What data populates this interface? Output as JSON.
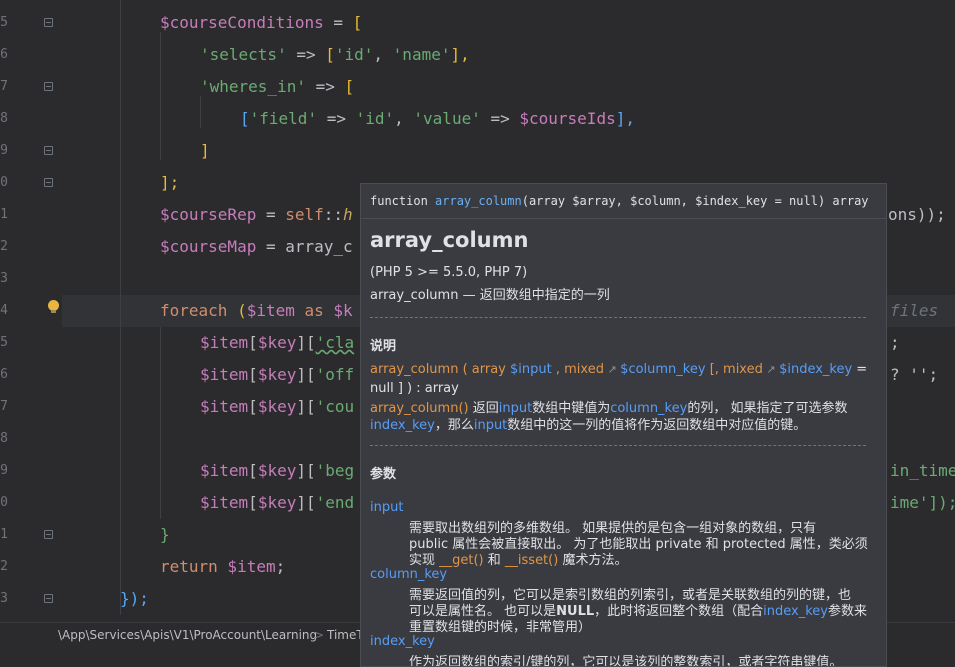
{
  "line_numbers": [
    "5",
    "6",
    "7",
    "8",
    "9",
    "0",
    "1",
    "2",
    "3",
    "4",
    "5",
    "6",
    "7",
    "8",
    "9",
    "0",
    "1",
    "2",
    "3"
  ],
  "code": {
    "line0_var": "$courseConditions",
    "line0_op": " = ",
    "line0_br": "[",
    "line1_key": "'selects'",
    "line1_arrow": " => ",
    "line1_rest_open": "[",
    "line1_a": "'id'",
    "line1_sep": ", ",
    "line1_b": "'name'",
    "line1_close": "],",
    "line2_key": "'wheres_in'",
    "line2_arrow": " => ",
    "line2_br": "[",
    "line3_open": "[",
    "line3_k1": "'field'",
    "line3_arrow1": " => ",
    "line3_v1": "'id'",
    "line3_sep": ", ",
    "line3_k2": "'value'",
    "line3_arrow2": " => ",
    "line3_v2": "$courseIds",
    "line3_close": "],",
    "line4": "]",
    "line5": "];",
    "line6_var": "$courseRep",
    "line6_op": " = ",
    "line6_self": "self",
    "line6_dc": "::",
    "line6_h": "h",
    "line6_tail": "ons));",
    "line7_var": "$courseMap",
    "line7_op": " = ",
    "line7_fn": "array_c",
    "line9_kw": "foreach",
    "line9_paren": " (",
    "line9_item": "$item",
    "line9_as": " as ",
    "line9_k": "$k",
    "line9_hint": "files",
    "line10_var": "$item",
    "line10_br": "[",
    "line10_key": "$key",
    "line10_br2": "][",
    "line10_s": "'cla",
    "line10_tail": ";",
    "line11_s": "'off",
    "line11_tail": "? '';",
    "line12_s": "'cou",
    "line14_s": "'beg",
    "line14_tail": "in_time",
    "line15_s": "'end",
    "line15_tail": "ime']);",
    "line16": "}",
    "line17_kw": "return",
    "line17_var": " $item",
    "line17_semi": ";",
    "line18": "});"
  },
  "statusbar": {
    "breadcrumb": "\\App\\Services\\Apis\\V1\\ProAccount\\Learning",
    "sep": ">",
    "next": "TimeT"
  },
  "popup": {
    "sig_prefix": "function ",
    "sig_name": "array_column",
    "sig_params": "(array $array, $column, $index_key = null) array",
    "title": "array_column",
    "version": "(PHP 5 >= 5.5.0, PHP 7)",
    "summary": "array_column — 返回数组中指定的一列",
    "desc_heading": "说明",
    "proto_name": "array_column",
    "proto_p1": " ( array ",
    "proto_input": "$input",
    "proto_p2": " , mixed",
    "proto_col": "$column_key",
    "proto_p3": " [, mixed",
    "proto_idx": "$index_key",
    "proto_p4": " =",
    "proto_line2": "null ] ) : array",
    "d1_fn": "array_column()",
    "d1_a": " 返回",
    "d1_input": "input",
    "d1_b": "数组中键值为",
    "d1_col": "column_key",
    "d1_c": "的列， 如果指定了可选参数",
    "d2_idx": "index_key",
    "d2_a": "，那么",
    "d2_input": "input",
    "d2_b": "数组中的这一列的值将作为返回数组中对应值的键。",
    "params_heading": "参数",
    "p_input": "input",
    "p_input_l1": "需要取出数组列的多维数组。 如果提供的是包含一组对象的数组，只有",
    "p_input_l2": "public 属性会被直接取出。 为了也能取出 private 和 protected 属性，类必须",
    "p_input_l3a": "实现 ",
    "p_input_get": "__get()",
    "p_input_l3b": " 和 ",
    "p_input_isset": "__isset()",
    "p_input_l3c": " 魔术方法。",
    "p_col": "column_key",
    "p_col_l1": "需要返回值的列，它可以是索引数组的列索引，或者是关联数组的列的键，也",
    "p_col_l2a": "可以是属性名。 也可以是",
    "p_col_null": "NULL",
    "p_col_l2b": "，此时将返回整个数组（配合",
    "p_col_idx": "index_key",
    "p_col_l2c": "参数来",
    "p_col_l3": "重置数组键的时候，非常管用）",
    "p_idx": "index_key",
    "p_idx_l1": "作为返回数组的索引/键的列，它可以是该列的整数索引，或者字符串键值。"
  },
  "colors": {
    "background": "#2b2b2d",
    "variable": "#c77dbb",
    "string": "#6aab73",
    "keyword": "#cf8e6d",
    "bracket": "#e8ba36",
    "link": "#589df6",
    "popup_bg": "#393b40"
  },
  "icons": [
    "fold-marker-icon",
    "bulb-icon",
    "arrow-icon"
  ]
}
